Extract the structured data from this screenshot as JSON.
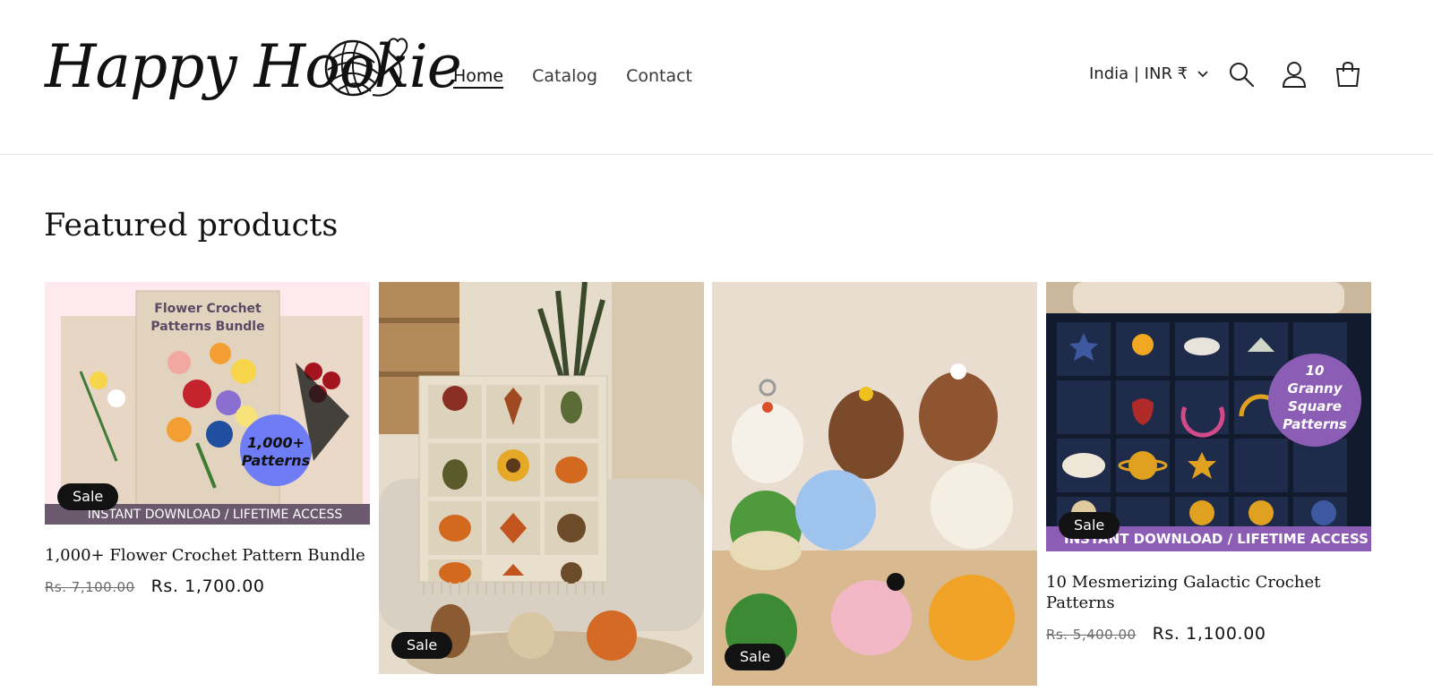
{
  "header": {
    "logo_text": "Happy Hookie",
    "nav": [
      {
        "label": "Home",
        "active": true
      },
      {
        "label": "Catalog",
        "active": false
      },
      {
        "label": "Contact",
        "active": false
      }
    ],
    "locale": "India | INR ₹",
    "icons": [
      "search-icon",
      "account-icon",
      "cart-icon"
    ]
  },
  "section": {
    "title": "Featured products"
  },
  "products": [
    {
      "title": "1,000+ Flower Crochet Pattern Bundle",
      "badge": "Sale",
      "price_old": "Rs. 7,100.00",
      "price_new": "Rs. 1,700.00",
      "image_header": "Flower Crochet Patterns Bundle",
      "image_badge_line1": "1,000+",
      "image_badge_line2": "Patterns",
      "image_footer": "INSTANT DOWNLOAD / LIFETIME ACCESS"
    },
    {
      "title": "",
      "badge": "Sale",
      "price_old": "",
      "price_new": ""
    },
    {
      "title": "",
      "badge": "Sale",
      "price_old": "",
      "price_new": ""
    },
    {
      "title": "10 Mesmerizing Galactic Crochet Patterns",
      "badge": "Sale",
      "price_old": "Rs. 5,400.00",
      "price_new": "Rs. 1,100.00",
      "image_badge_line1": "10",
      "image_badge_line2": "Granny",
      "image_badge_line3": "Square",
      "image_badge_line4": "Patterns",
      "image_footer": "INSTANT DOWNLOAD / LIFETIME ACCESS"
    }
  ],
  "colors": {
    "text": "#121212",
    "badge_bg": "#121212",
    "accent_purple": "#8b5db5",
    "accent_blue": "#6e7cf5"
  }
}
